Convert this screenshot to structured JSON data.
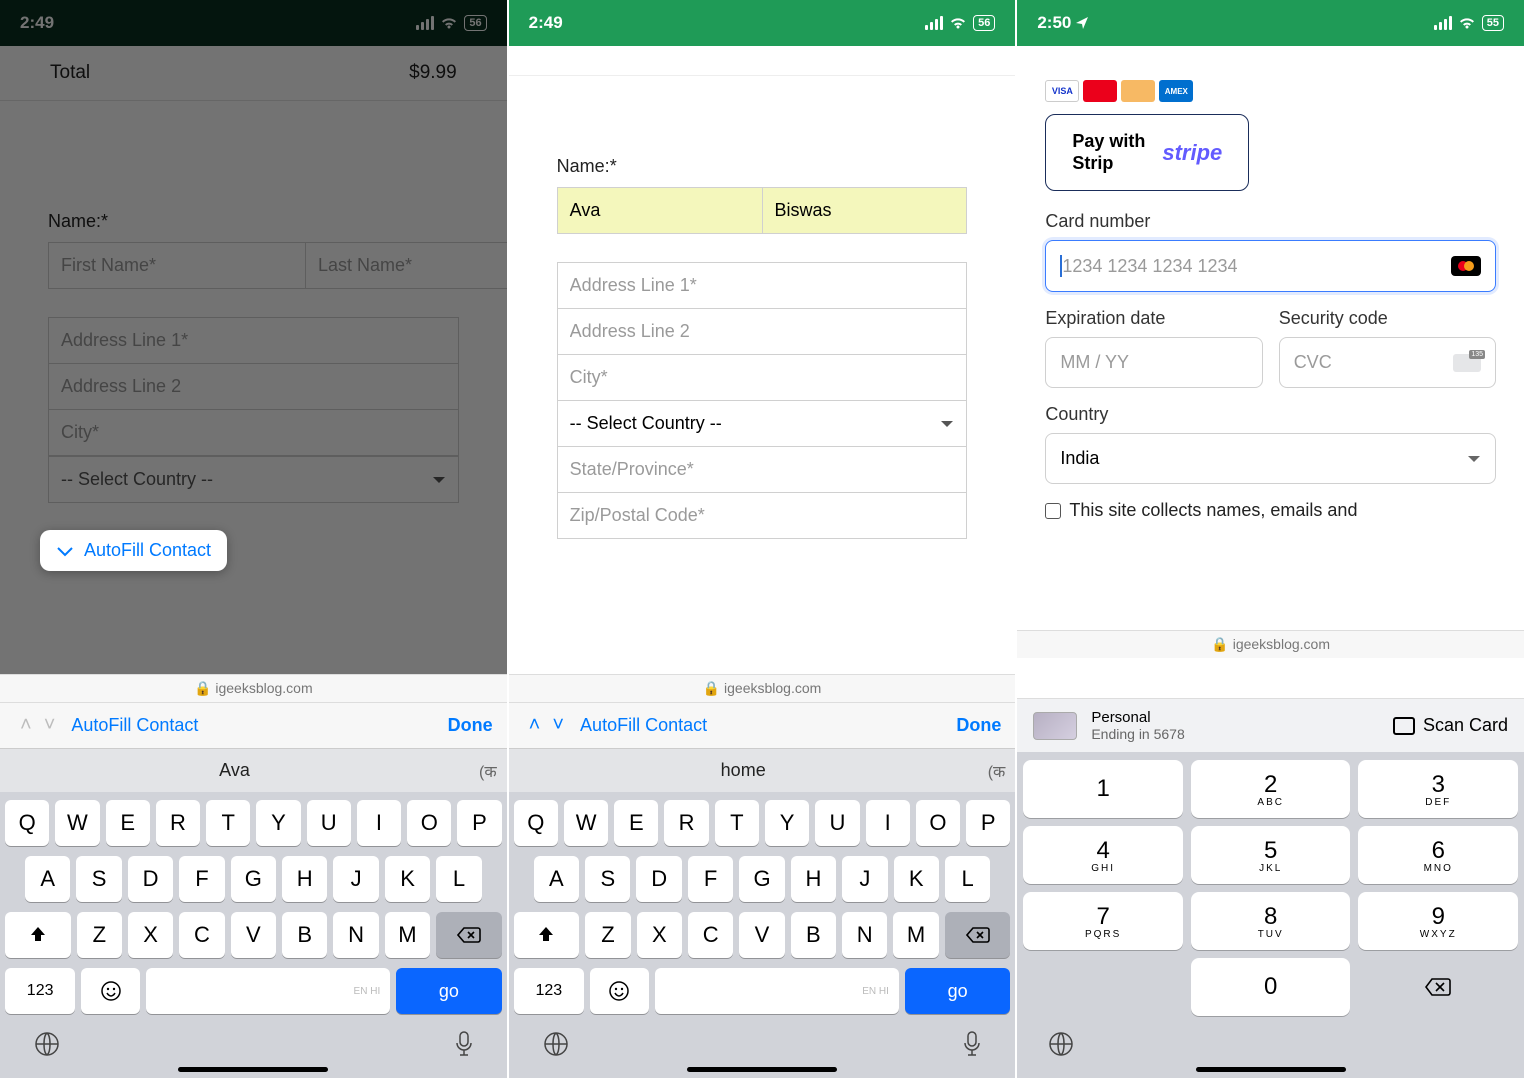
{
  "status": {
    "time1": "2:49",
    "time2": "2:49",
    "time3": "2:50",
    "battery1": "56",
    "battery2": "56",
    "battery3": "55"
  },
  "screen1": {
    "total_label": "Total",
    "total_value": "$9.99",
    "name_label": "Name:*",
    "first_name_ph": "First Name*",
    "last_name_ph": "Last Name*",
    "addr1_ph": "Address Line 1*",
    "addr2_ph": "Address Line 2",
    "city_ph": "City*",
    "select_country": "-- Select Country --",
    "url": "igeeksblog.com",
    "autofill": "AutoFill Contact",
    "done": "Done",
    "suggest": "Ava",
    "lang": "(क"
  },
  "screen2": {
    "name_label": "Name:*",
    "first_name": "Ava",
    "last_name": "Biswas",
    "addr1_ph": "Address Line 1*",
    "addr2_ph": "Address Line 2",
    "city_ph": "City*",
    "select_country": "-- Select Country --",
    "state_ph": "State/Province*",
    "zip_ph": "Zip/Postal Code*",
    "url": "igeeksblog.com",
    "autofill": "AutoFill Contact",
    "done": "Done",
    "suggest": "home",
    "lang": "(क"
  },
  "screen3": {
    "pay_with": "Pay with Strip",
    "stripe": "stripe",
    "card_number_label": "Card number",
    "card_ph": "1234 1234 1234 1234",
    "exp_label": "Expiration date",
    "exp_ph": "MM / YY",
    "sec_label": "Security code",
    "cvc_ph": "CVC",
    "country_label": "Country",
    "country_value": "India",
    "consent": "This site collects names, emails and",
    "url": "igeeksblog.com",
    "cc_name": "Personal",
    "cc_ending": "Ending in 5678",
    "scan_card": "Scan Card"
  },
  "qwerty": {
    "r1": [
      "Q",
      "W",
      "E",
      "R",
      "T",
      "Y",
      "U",
      "I",
      "O",
      "P"
    ],
    "r2": [
      "A",
      "S",
      "D",
      "F",
      "G",
      "H",
      "J",
      "K",
      "L"
    ],
    "r3": [
      "Z",
      "X",
      "C",
      "V",
      "B",
      "N",
      "M"
    ],
    "key_123": "123",
    "key_go": "go",
    "space_label": "EN HI"
  },
  "numpad": {
    "keys": [
      {
        "d": "1",
        "s": ""
      },
      {
        "d": "2",
        "s": "ABC"
      },
      {
        "d": "3",
        "s": "DEF"
      },
      {
        "d": "4",
        "s": "GHI"
      },
      {
        "d": "5",
        "s": "JKL"
      },
      {
        "d": "6",
        "s": "MNO"
      },
      {
        "d": "7",
        "s": "PQRS"
      },
      {
        "d": "8",
        "s": "TUV"
      },
      {
        "d": "9",
        "s": "WXYZ"
      },
      {
        "d": "0",
        "s": ""
      }
    ]
  }
}
